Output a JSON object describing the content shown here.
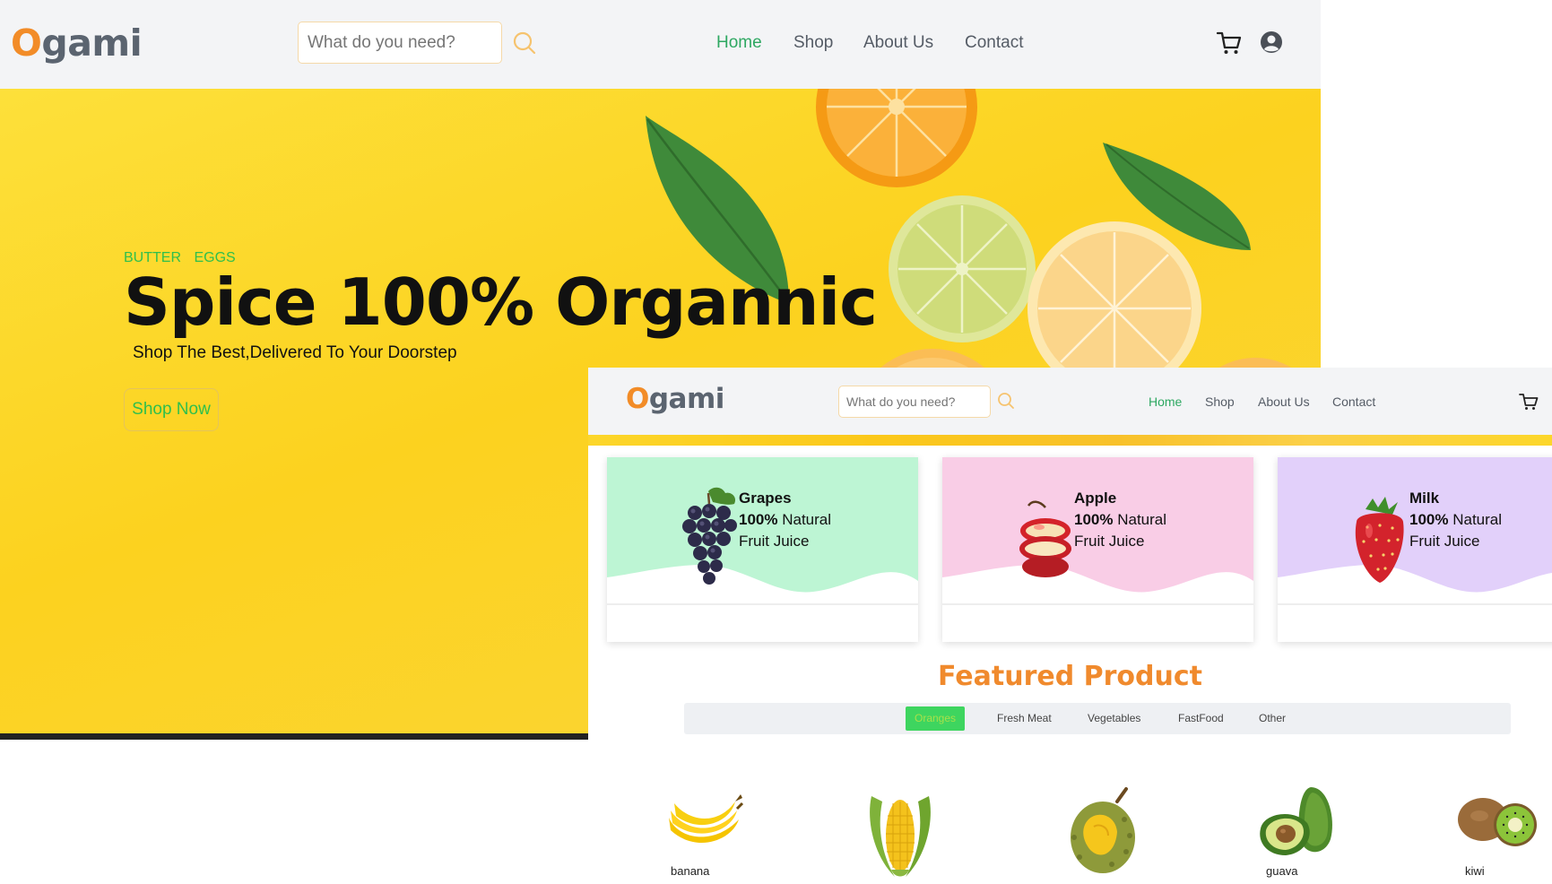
{
  "back": {
    "logo": {
      "initial": "O",
      "rest": "gami"
    },
    "search": {
      "placeholder": "What do you need?"
    },
    "nav": [
      "Home",
      "Shop",
      "About Us",
      "Contact"
    ],
    "hero": {
      "tags": [
        "BUTTER",
        "EGGS"
      ],
      "title": "Spice 100% Organnic",
      "subtitle": "Shop The Best,Delivered To Your Doorstep",
      "button": "Shop Now"
    }
  },
  "front": {
    "logo": {
      "initial": "O",
      "rest": "gami"
    },
    "search": {
      "placeholder": "What do you need?"
    },
    "nav": [
      "Home",
      "Shop",
      "About Us",
      "Contact"
    ],
    "categories": [
      {
        "name": "Grapes",
        "line2_bold": "100%",
        "line2_rest": " Natural",
        "line3": "Fruit Juice",
        "color": "#bdf5d4"
      },
      {
        "name": "Apple",
        "line2_bold": "100%",
        "line2_rest": " Natural",
        "line3": "Fruit Juice",
        "color": "#f9cde6"
      },
      {
        "name": "Milk",
        "line2_bold": "100%",
        "line2_rest": " Natural",
        "line3": "Fruit Juice",
        "color": "#e2d0fa"
      }
    ],
    "featured_title": "Featured Product",
    "filters": [
      "Oranges",
      "Fresh Meat",
      "Vegetables",
      "FastFood",
      "Other"
    ],
    "products": [
      "banana",
      "",
      "",
      "guava",
      "kiwi"
    ]
  },
  "colors": {
    "accent_orange": "#f28c28",
    "active_green": "#2ea862",
    "tag_green": "#2fbf4c",
    "hero_yellow": "#fcd21f"
  }
}
